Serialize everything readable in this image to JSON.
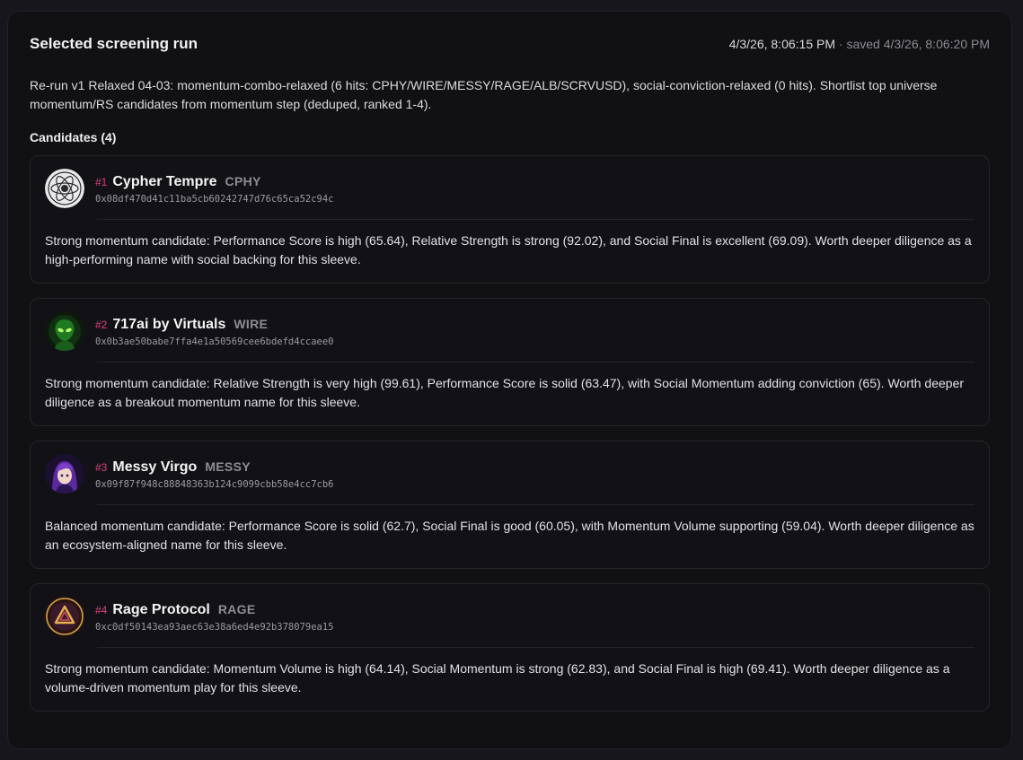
{
  "panel": {
    "title": "Selected screening run",
    "run_time": "4/3/26, 8:06:15 PM",
    "saved_text": " · saved 4/3/26, 8:06:20 PM",
    "summary": "Re-run v1 Relaxed 04-03: momentum-combo-relaxed (6 hits: CPHY/WIRE/MESSY/RAGE/ALB/SCRVUSD), social-conviction-relaxed (0 hits). Shortlist top universe momentum/RS candidates from momentum step (deduped, ranked 1-4).",
    "candidates_heading": "Candidates (4)"
  },
  "candidates": [
    {
      "rank": "#1",
      "name": "Cypher Tempre",
      "ticker": "CPHY",
      "address": "0x08df470d41c11ba5cb60242747d76c65ca52c94c",
      "description": "Strong momentum candidate: Performance Score is high (65.64), Relative Strength is strong (92.02), and Social Final is excellent (69.09). Worth deeper diligence as a high-performing name with social backing for this sleeve.",
      "icon": "atom-logo-icon"
    },
    {
      "rank": "#2",
      "name": "717ai by Virtuals",
      "ticker": "WIRE",
      "address": "0x0b3ae50babe7ffa4e1a50569cee6bdefd4ccaee0",
      "description": "Strong momentum candidate: Relative Strength is very high (99.61), Performance Score is solid (63.47), with Social Momentum adding conviction (65). Worth deeper diligence as a breakout momentum name for this sleeve.",
      "icon": "alien-logo-icon"
    },
    {
      "rank": "#3",
      "name": "Messy Virgo",
      "ticker": "MESSY",
      "address": "0x09f87f948c88848363b124c9099cbb58e4cc7cb6",
      "description": "Balanced momentum candidate: Performance Score is solid (62.7), Social Final is good (60.05), with Momentum Volume supporting (59.04). Worth deeper diligence as an ecosystem-aligned name for this sleeve.",
      "icon": "anime-girl-logo-icon"
    },
    {
      "rank": "#4",
      "name": "Rage Protocol",
      "ticker": "RAGE",
      "address": "0xc0df50143ea93aec63e38a6ed4e92b378079ea15",
      "description": "Strong momentum candidate: Momentum Volume is high (64.14), Social Momentum is strong (62.83), and Social Final is high (69.41). Worth deeper diligence as a volume-driven momentum play for this sleeve.",
      "icon": "triangle-logo-icon"
    }
  ],
  "colors": {
    "background": "#16161c",
    "panel": "#111114",
    "rank_accent": "#e0407a",
    "muted": "#8d8d96"
  }
}
